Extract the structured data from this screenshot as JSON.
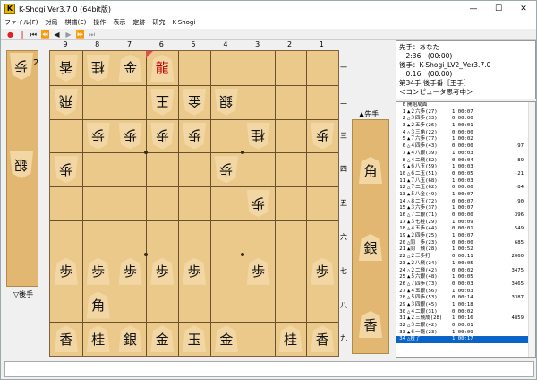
{
  "window": {
    "title": "K-Shogi Ver3.7.0 (64bit版)",
    "app_icon": "K",
    "minimize": "—",
    "maximize": "☐",
    "close": "✕"
  },
  "menu": [
    "ファイル(F)",
    "対局",
    "棋譜(E)",
    "操作",
    "表示",
    "定跡",
    "研究",
    "K-Shogi"
  ],
  "toolbar": [
    {
      "icon": "record-icon",
      "glyph": "●"
    },
    {
      "icon": "pause-icon",
      "glyph": "‖"
    },
    {
      "icon": "first-move-icon",
      "glyph": "⏮"
    },
    {
      "icon": "prev-10-icon",
      "glyph": "⏪"
    },
    {
      "icon": "prev-icon",
      "glyph": "◀"
    },
    {
      "icon": "next-icon",
      "glyph": "▶"
    },
    {
      "icon": "next-10-icon",
      "glyph": "⏩"
    },
    {
      "icon": "last-move-icon",
      "glyph": "⏭"
    }
  ],
  "board": {
    "files": [
      "9",
      "8",
      "7",
      "6",
      "5",
      "4",
      "3",
      "2",
      "1"
    ],
    "ranks": [
      "一",
      "二",
      "三",
      "四",
      "五",
      "六",
      "七",
      "八",
      "九"
    ],
    "pieces": [
      {
        "file": 9,
        "rank": 1,
        "ch": "香",
        "side": "gote"
      },
      {
        "file": 8,
        "rank": 1,
        "ch": "桂",
        "side": "gote"
      },
      {
        "file": 7,
        "rank": 1,
        "ch": "金",
        "side": "sente"
      },
      {
        "file": 6,
        "rank": 1,
        "ch": "龍",
        "side": "sente",
        "red": true
      },
      {
        "file": 9,
        "rank": 2,
        "ch": "飛",
        "side": "gote"
      },
      {
        "file": 6,
        "rank": 2,
        "ch": "王",
        "side": "gote"
      },
      {
        "file": 5,
        "rank": 2,
        "ch": "金",
        "side": "gote"
      },
      {
        "file": 4,
        "rank": 2,
        "ch": "銀",
        "side": "gote"
      },
      {
        "file": 8,
        "rank": 3,
        "ch": "歩",
        "side": "gote"
      },
      {
        "file": 7,
        "rank": 3,
        "ch": "歩",
        "side": "gote"
      },
      {
        "file": 6,
        "rank": 3,
        "ch": "歩",
        "side": "gote"
      },
      {
        "file": 5,
        "rank": 3,
        "ch": "歩",
        "side": "gote"
      },
      {
        "file": 3,
        "rank": 3,
        "ch": "桂",
        "side": "gote"
      },
      {
        "file": 1,
        "rank": 3,
        "ch": "歩",
        "side": "gote"
      },
      {
        "file": 9,
        "rank": 4,
        "ch": "歩",
        "side": "gote"
      },
      {
        "file": 4,
        "rank": 4,
        "ch": "歩",
        "side": "gote"
      },
      {
        "file": 3,
        "rank": 5,
        "ch": "歩",
        "side": "gote"
      },
      {
        "file": 9,
        "rank": 7,
        "ch": "歩",
        "side": "sente"
      },
      {
        "file": 8,
        "rank": 7,
        "ch": "歩",
        "side": "sente"
      },
      {
        "file": 7,
        "rank": 7,
        "ch": "歩",
        "side": "sente"
      },
      {
        "file": 6,
        "rank": 7,
        "ch": "歩",
        "side": "sente"
      },
      {
        "file": 5,
        "rank": 7,
        "ch": "歩",
        "side": "sente"
      },
      {
        "file": 3,
        "rank": 7,
        "ch": "歩",
        "side": "sente"
      },
      {
        "file": 1,
        "rank": 7,
        "ch": "歩",
        "side": "sente"
      },
      {
        "file": 8,
        "rank": 8,
        "ch": "角",
        "side": "sente"
      },
      {
        "file": 9,
        "rank": 9,
        "ch": "香",
        "side": "sente"
      },
      {
        "file": 8,
        "rank": 9,
        "ch": "桂",
        "side": "sente"
      },
      {
        "file": 7,
        "rank": 9,
        "ch": "銀",
        "side": "sente"
      },
      {
        "file": 6,
        "rank": 9,
        "ch": "金",
        "side": "sente"
      },
      {
        "file": 5,
        "rank": 9,
        "ch": "玉",
        "side": "sente"
      },
      {
        "file": 4,
        "rank": 9,
        "ch": "金",
        "side": "sente"
      },
      {
        "file": 2,
        "rank": 9,
        "ch": "桂",
        "side": "sente"
      },
      {
        "file": 1,
        "rank": 9,
        "ch": "香",
        "side": "sente"
      }
    ],
    "last_move": {
      "file": 6,
      "rank": 1
    }
  },
  "gote_hand": {
    "label": "▽後手",
    "pieces": [
      {
        "ch": "歩",
        "count": "2"
      },
      {
        "ch": "銀",
        "count": ""
      }
    ]
  },
  "sente_hand": {
    "label": "▲先手",
    "pieces": [
      {
        "ch": "角",
        "count": ""
      },
      {
        "ch": "銀",
        "count": ""
      },
      {
        "ch": "香",
        "count": ""
      }
    ]
  },
  "info": {
    "line1": "先手：あなた",
    "line2": "　2:36　(00:00)",
    "line3": "後手：K-Shogi_LV2_Ver3.7.0",
    "line4": "　0:16　(00:00)",
    "line5": "第34手 後手番［王手］",
    "line6": "＜コンピュータ思考中＞"
  },
  "moves": [
    {
      "n": "0",
      "m": "開始局面",
      "t": "",
      "s": ""
    },
    {
      "n": "1",
      "m": "▲２六歩(27)",
      "t": "1 00:07",
      "s": ""
    },
    {
      "n": "2",
      "m": "△３四歩(33)",
      "t": "0 00:00",
      "s": ""
    },
    {
      "n": "3",
      "m": "▲２五歩(26)",
      "t": "1 00:01",
      "s": ""
    },
    {
      "n": "4",
      "m": "△３三角(22)",
      "t": "0 00:00",
      "s": ""
    },
    {
      "n": "5",
      "m": "▲７六歩(77)",
      "t": "1 00:02",
      "s": ""
    },
    {
      "n": "6",
      "m": "△４四歩(43)",
      "t": "0 00:00",
      "s": "-97"
    },
    {
      "n": "7",
      "m": "▲４八銀(39)",
      "t": "1 00:03",
      "s": ""
    },
    {
      "n": "8",
      "m": "△４二飛(82)",
      "t": "0 00:04",
      "s": "-89"
    },
    {
      "n": "9",
      "m": "▲６八玉(59)",
      "t": "1 00:03",
      "s": ""
    },
    {
      "n": "10",
      "m": "△６二玉(51)",
      "t": "0 00:05",
      "s": "-21"
    },
    {
      "n": "11",
      "m": "▲７八玉(68)",
      "t": "1 00:03",
      "s": ""
    },
    {
      "n": "12",
      "m": "△７二玉(62)",
      "t": "0 00:00",
      "s": "-84"
    },
    {
      "n": "13",
      "m": "▲５八金(49)",
      "t": "1 00:07",
      "s": ""
    },
    {
      "n": "14",
      "m": "△８二玉(72)",
      "t": "0 00:07",
      "s": "-90"
    },
    {
      "n": "15",
      "m": "▲３六歩(37)",
      "t": "1 00:07",
      "s": ""
    },
    {
      "n": "16",
      "m": "△７二銀(71)",
      "t": "0 00:00",
      "s": "396"
    },
    {
      "n": "17",
      "m": "▲３七桂(29)",
      "t": "1 00:09",
      "s": ""
    },
    {
      "n": "18",
      "m": "△４五歩(44)",
      "t": "0 00:01",
      "s": "549"
    },
    {
      "n": "19",
      "m": "▲２四歩(25)",
      "t": "1 00:07",
      "s": ""
    },
    {
      "n": "20",
      "m": "△同　歩(23)",
      "t": "0 00:00",
      "s": "685"
    },
    {
      "n": "21",
      "m": "▲同　飛(28)",
      "t": "1 00:52",
      "s": ""
    },
    {
      "n": "22",
      "m": "△２三歩打",
      "t": "0 00:11",
      "s": "2060"
    },
    {
      "n": "23",
      "m": "▲２八飛(24)",
      "t": "1 00:05",
      "s": ""
    },
    {
      "n": "24",
      "m": "△２二飛(42)",
      "t": "0 00:02",
      "s": "3475"
    },
    {
      "n": "25",
      "m": "▲５六銀(48)",
      "t": "1 00:05",
      "s": ""
    },
    {
      "n": "26",
      "m": "△７四歩(73)",
      "t": "0 00:03",
      "s": "3465"
    },
    {
      "n": "27",
      "m": "▲４五銀(56)",
      "t": "1 00:03",
      "s": ""
    },
    {
      "n": "28",
      "m": "△５四歩(53)",
      "t": "0 00:14",
      "s": "3387"
    },
    {
      "n": "29",
      "m": "▲３四銀(45)",
      "t": "1 00:18",
      "s": ""
    },
    {
      "n": "30",
      "m": "△４二銀(31)",
      "t": "0 00:02",
      "s": ""
    },
    {
      "n": "31",
      "m": "▲２三飛成(28)",
      "t": "1 00:16",
      "s": "4859"
    },
    {
      "n": "32",
      "m": "△３二銀(42)",
      "t": "0 00:01",
      "s": ""
    },
    {
      "n": "33",
      "m": "▲６一龍(23)",
      "t": "1 00:09",
      "s": ""
    },
    {
      "n": "34",
      "m": "△投了",
      "t": "1 00:17",
      "s": "",
      "selected": true
    }
  ],
  "colors": {
    "board": "#eac98a",
    "stand": "#e2b772",
    "piece": "#f2d7a4",
    "selection": "#0a64c8",
    "last_move_marker": "#e05050"
  }
}
